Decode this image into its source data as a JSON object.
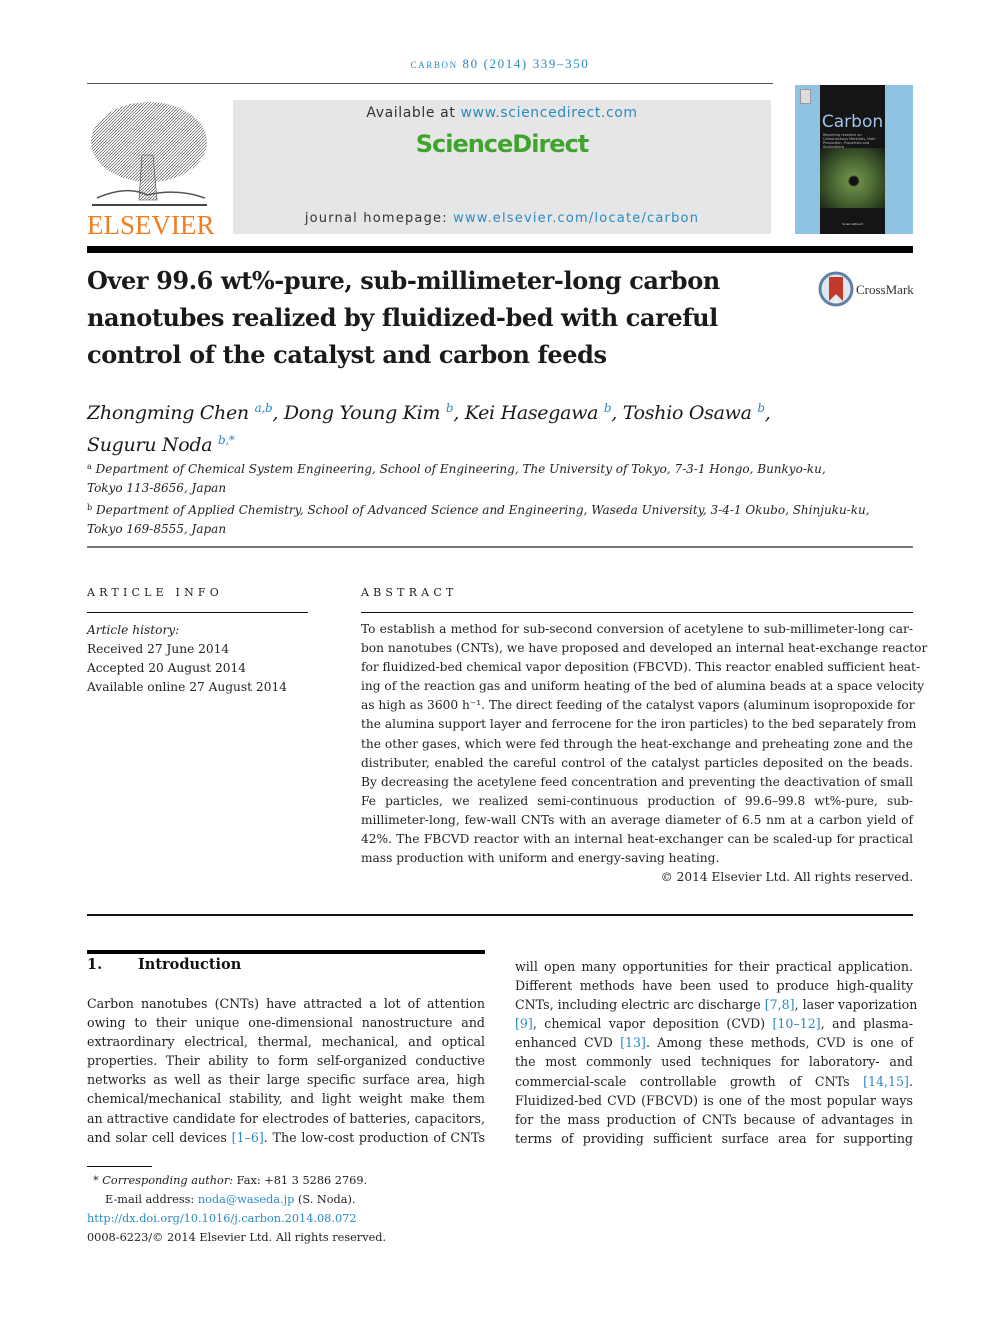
{
  "running_head": "carbon 80 (2014) 339–350",
  "header": {
    "publisher_logo_text": "ELSEVIER",
    "available_prefix": "Available at ",
    "available_link": "www.sciencedirect.com",
    "sciencedirect_logo": "ScienceDirect",
    "homepage_prefix": "journal homepage: ",
    "homepage_link": "www.elsevier.com/locate/carbon",
    "cover_title": "Carbon",
    "cover_subtitle": "Reporting research on Carbonaceous Materials, their Production, Properties and Applications",
    "cover_publisher": "ScienceDirect"
  },
  "title": "Over 99.6 wt%-pure, sub-millimeter-long carbon nanotubes realized by fluidized-bed with careful control of the catalyst and carbon feeds",
  "title_lines": [
    "Over 99.6 wt%-pure, sub-millimeter-long carbon",
    "nanotubes realized by fluidized-bed with careful",
    "control of the catalyst and carbon feeds"
  ],
  "crossmark_label": "CrossMark",
  "authors": [
    {
      "name": "Zhongming Chen",
      "affil": "a,b",
      "sep": ", "
    },
    {
      "name": "Dong Young Kim",
      "affil": "b",
      "sep": ", "
    },
    {
      "name": "Kei Hasegawa",
      "affil": "b",
      "sep": ", "
    },
    {
      "name": "Toshio Osawa",
      "affil": "b",
      "sep": ","
    },
    {
      "name": "Suguru Noda",
      "affil": "b,*",
      "sep": ""
    }
  ],
  "affiliations": [
    {
      "mark": "a",
      "line1": "Department of Chemical System Engineering, School of Engineering, The University of Tokyo, 7-3-1 Hongo, Bunkyo-ku,",
      "line2": "Tokyo 113-8656, Japan"
    },
    {
      "mark": "b",
      "line1": "Department of Applied Chemistry, School of Advanced Science and Engineering, Waseda University, 3-4-1 Okubo, Shinjuku-ku,",
      "line2": "Tokyo 169-8555, Japan"
    }
  ],
  "article_info": {
    "heading": "ARTICLE INFO",
    "history_label": "Article history:",
    "received": "Received 27 June 2014",
    "accepted": "Accepted 20 August 2014",
    "online": "Available online 27 August 2014"
  },
  "abstract": {
    "heading": "ABSTRACT",
    "lines": [
      "To establish a method for sub-second conversion of acetylene to sub-millimeter-long car-",
      "bon nanotubes (CNTs), we have proposed and developed an internal heat-exchange reactor",
      "for fluidized-bed chemical vapor deposition (FBCVD). This reactor enabled sufficient heat-",
      "ing of the reaction gas and uniform heating of the bed of alumina beads at a space velocity",
      "as high as 3600 h⁻¹. The direct feeding of the catalyst vapors (aluminum isopropoxide for",
      "the alumina support layer and ferrocene for the iron particles) to the bed separately from",
      "the other gases, which were fed through the heat-exchange and preheating zone and the",
      "distributer, enabled the careful control of the catalyst particles deposited on the beads.",
      "By decreasing the acetylene feed concentration and preventing the deactivation of small",
      "Fe particles, we realized semi-continuous production of 99.6–99.8 wt%-pure, sub-",
      "millimeter-long, few-wall CNTs with an average diameter of 6.5 nm at a carbon yield of",
      "42%. The FBCVD reactor with an internal heat-exchanger can be scaled-up for practical",
      "mass production with uniform and energy-saving heating."
    ],
    "copyright": "© 2014 Elsevier Ltd. All rights reserved."
  },
  "introduction": {
    "number": "1.",
    "heading": "Introduction",
    "left_lines": [
      [
        {
          "t": "Carbon nanotubes (CNTs) have attracted a lot of attention"
        }
      ],
      [
        {
          "t": "owing to their unique one-dimensional nanostructure and"
        }
      ],
      [
        {
          "t": "extraordinary electrical, thermal, mechanical, and optical"
        }
      ],
      [
        {
          "t": "properties. Their ability to form self-organized conductive"
        }
      ],
      [
        {
          "t": "networks as well as their large specific surface area, high"
        }
      ],
      [
        {
          "t": "chemical/mechanical stability, and light weight make them"
        }
      ],
      [
        {
          "t": "an attractive candidate for electrodes of batteries, capacitors,"
        }
      ],
      [
        {
          "t": "and solar cell devices "
        },
        {
          "t": "[1–6]",
          "ref": true
        },
        {
          "t": ". The low-cost production of CNTs"
        }
      ]
    ],
    "right_lines": [
      [
        {
          "t": "will open many opportunities for their practical application."
        }
      ],
      [
        {
          "t": "Different methods have been used to produce high-quality"
        }
      ],
      [
        {
          "t": "CNTs, including electric arc discharge "
        },
        {
          "t": "[7,8]",
          "ref": true
        },
        {
          "t": ", laser vaporization"
        }
      ],
      [
        {
          "t": "[9]",
          "ref": true
        },
        {
          "t": ", chemical vapor deposition (CVD) "
        },
        {
          "t": "[10–12]",
          "ref": true
        },
        {
          "t": ", and plasma-"
        }
      ],
      [
        {
          "t": "enhanced CVD "
        },
        {
          "t": "[13]",
          "ref": true
        },
        {
          "t": ". Among these methods, CVD is one of"
        }
      ],
      [
        {
          "t": "the most commonly used techniques for laboratory- and"
        }
      ],
      [
        {
          "t": "commercial-scale controllable growth of CNTs "
        },
        {
          "t": "[14,15]",
          "ref": true
        },
        {
          "t": "."
        }
      ],
      [
        {
          "t": "Fluidized-bed CVD (FBCVD) is one of the most popular ways"
        }
      ],
      [
        {
          "t": "for the mass production of CNTs because of advantages in"
        }
      ],
      [
        {
          "t": "terms of providing sufficient surface area for supporting"
        }
      ]
    ]
  },
  "footnotes": {
    "corresponding_label": "Corresponding author:",
    "fax": " Fax: +81 3 5286 2769.",
    "email_label": "E-mail address: ",
    "email": "noda@waseda.jp",
    "email_suffix": " (S. Noda).",
    "doi": "http://dx.doi.org/10.1016/j.carbon.2014.08.072",
    "issn_copyright": "0008-6223/© 2014 Elsevier Ltd. All rights reserved."
  },
  "colors": {
    "link": "#2a8ac4",
    "elsevier_orange": "#f27c1e",
    "sciencedirect_green": "#3fa32c",
    "header_box": "#e6e6e6"
  }
}
